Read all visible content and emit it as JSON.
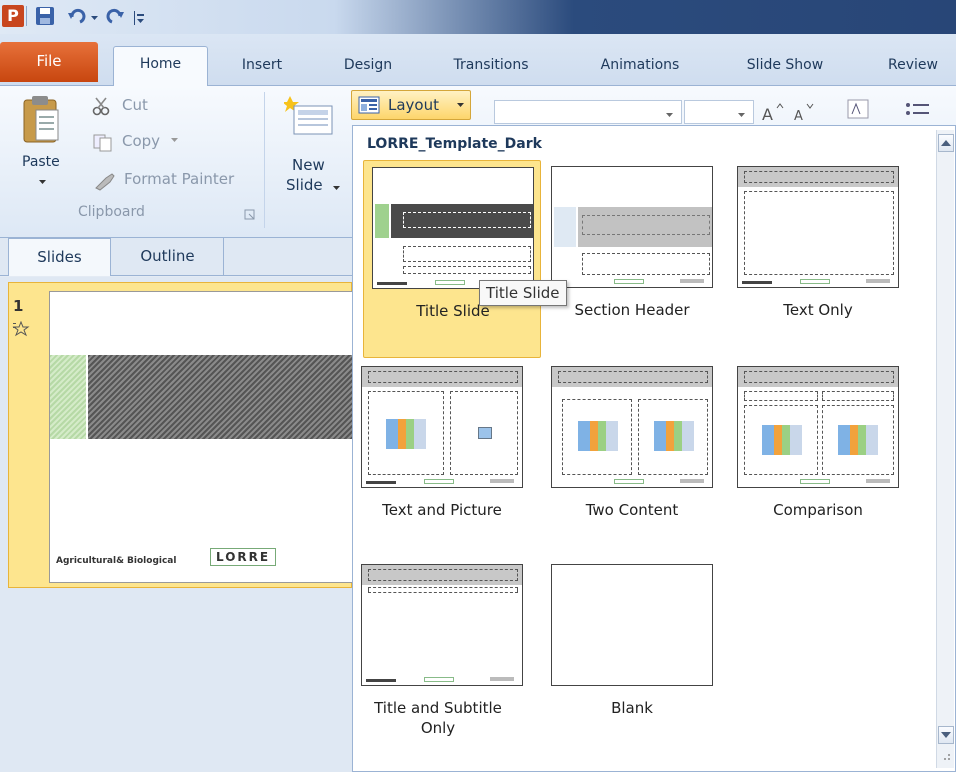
{
  "ribbon_tabs": [
    "File",
    "Home",
    "Insert",
    "Design",
    "Transitions",
    "Animations",
    "Slide Show",
    "Review"
  ],
  "clipboard": {
    "paste": "Paste",
    "cut": "Cut",
    "copy": "Copy",
    "format_painter": "Format Painter",
    "group_label": "Clipboard"
  },
  "slides_group": {
    "new_slide_line1": "New",
    "new_slide_line2": "Slide",
    "layout": "Layout"
  },
  "pane_tabs": {
    "slides": "Slides",
    "outline": "Outline"
  },
  "thumbnail": {
    "number": "1",
    "footer_left": "Agricultural& Biological",
    "footer_logo": "LORRE"
  },
  "gallery": {
    "title": "LORRE_Template_Dark",
    "tooltip": "Title Slide",
    "layouts": [
      {
        "name": "Title Slide",
        "selected": true
      },
      {
        "name": "Section Header"
      },
      {
        "name": "Text Only"
      },
      {
        "name": "Text and Picture"
      },
      {
        "name": "Two Content"
      },
      {
        "name": "Comparison"
      },
      {
        "name": "Title and Subtitle Only"
      },
      {
        "name": "Blank"
      }
    ]
  },
  "colors": {
    "file_tab": "#d4561e",
    "selection": "#fde58e",
    "accent": "#1e395b",
    "thumb_green": "#b6d9a6"
  }
}
